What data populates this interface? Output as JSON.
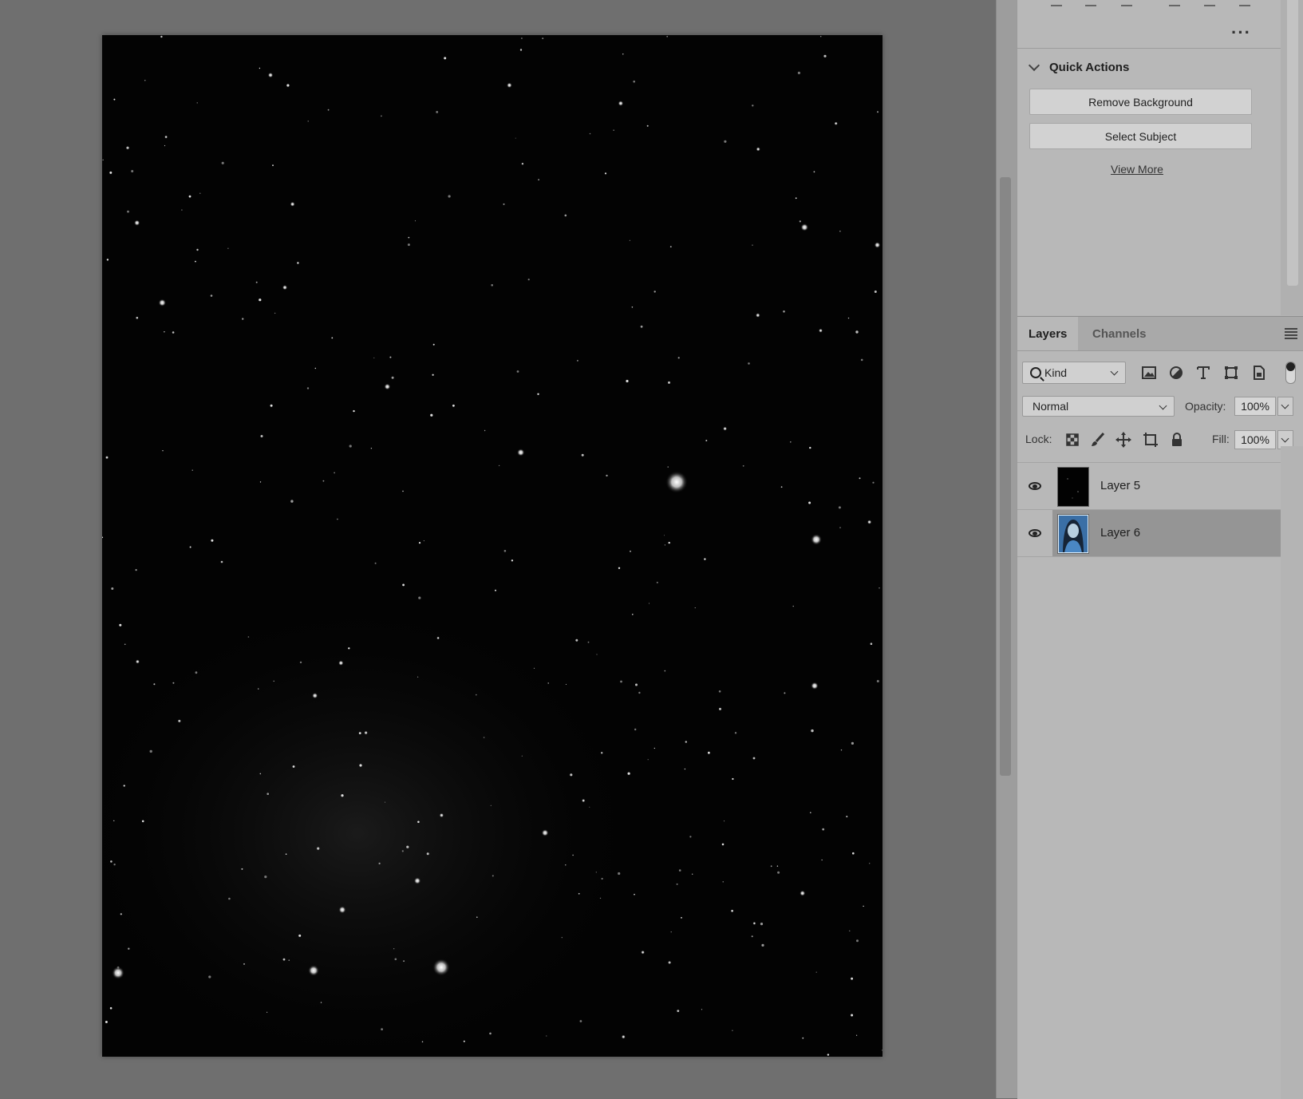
{
  "quick_actions": {
    "title": "Quick Actions",
    "remove_background": "Remove Background",
    "select_subject": "Select Subject",
    "view_more": "View More"
  },
  "layers_panel": {
    "tabs": [
      "Layers",
      "Channels"
    ],
    "filter_kind": "Kind",
    "blend_mode": "Normal",
    "opacity_label": "Opacity:",
    "opacity_value": "100%",
    "lock_label": "Lock:",
    "fill_label": "Fill:",
    "fill_value": "100%",
    "layers": [
      {
        "name": "Layer 5",
        "visible": true,
        "selected": false,
        "thumb": "black-starfield"
      },
      {
        "name": "Layer 6",
        "visible": true,
        "selected": true,
        "thumb": "portrait-blue"
      }
    ]
  },
  "icons": {
    "more": "more-icon",
    "panel_menu": "panel-menu-icon",
    "filter_pixel": "image-filter-icon",
    "filter_adjustment": "adjustment-filter-icon",
    "filter_type": "type-filter-icon",
    "filter_shape": "shape-filter-icon",
    "filter_smart": "smart-object-filter-icon",
    "lock_transparent": "lock-transparent-icon",
    "lock_image": "lock-image-icon",
    "lock_position": "lock-position-icon",
    "lock_artboard": "lock-artboard-icon",
    "lock_all": "lock-all-icon"
  },
  "colors": {
    "canvas": "#030303",
    "workspace": "#6f6f6f",
    "panel": "#b8b8b8",
    "selected_layer": "#959595"
  }
}
